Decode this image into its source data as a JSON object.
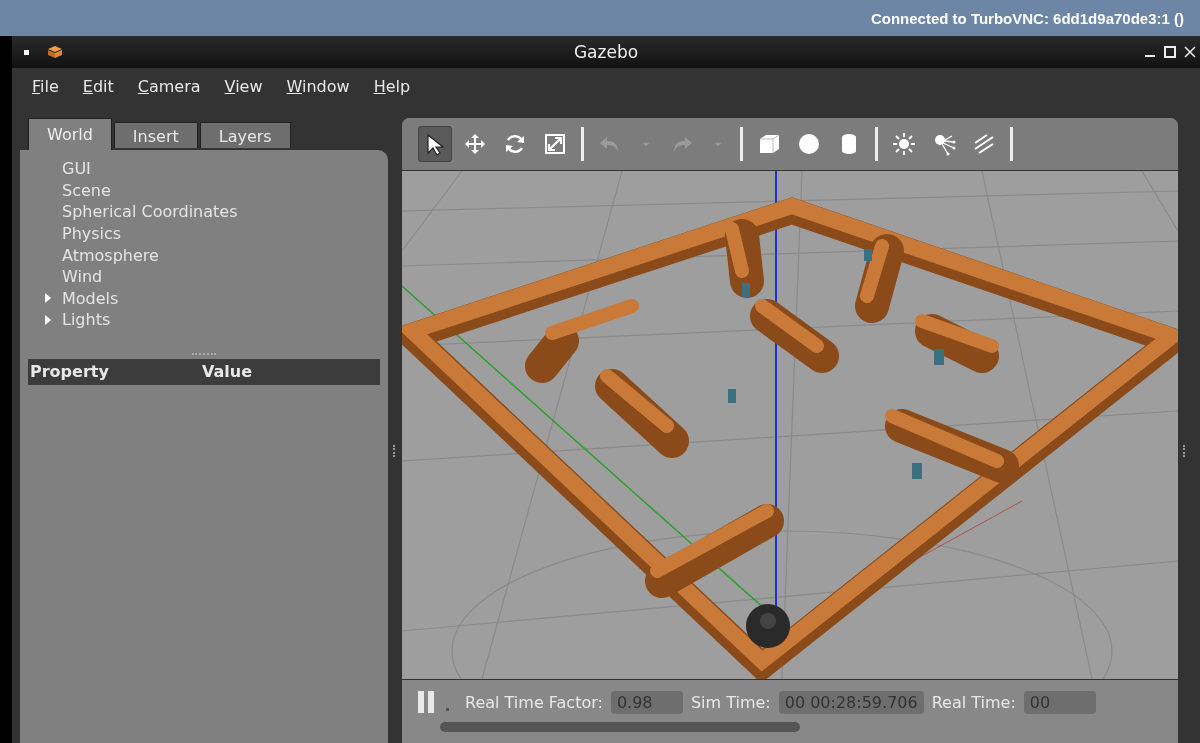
{
  "vnc_bar": {
    "title": "Connected to TurboVNC: 6dd1d9a70de3:1 ()"
  },
  "window": {
    "title": "Gazebo"
  },
  "menu": [
    "File",
    "Edit",
    "Camera",
    "View",
    "Window",
    "Help"
  ],
  "left_panel": {
    "tabs": [
      {
        "label": "World",
        "selected": true
      },
      {
        "label": "Insert",
        "selected": false
      },
      {
        "label": "Layers",
        "selected": false
      }
    ],
    "tree": [
      {
        "label": "GUI",
        "expandable": false
      },
      {
        "label": "Scene",
        "expandable": false
      },
      {
        "label": "Spherical Coordinates",
        "expandable": false
      },
      {
        "label": "Physics",
        "expandable": false
      },
      {
        "label": "Atmosphere",
        "expandable": false
      },
      {
        "label": "Wind",
        "expandable": false
      },
      {
        "label": "Models",
        "expandable": true
      },
      {
        "label": "Lights",
        "expandable": true
      }
    ],
    "property_table": {
      "columns": [
        "Property",
        "Value"
      ]
    }
  },
  "toolbar": [
    {
      "kind": "select",
      "selected": true,
      "disabled": false
    },
    {
      "kind": "translate",
      "selected": false,
      "disabled": false
    },
    {
      "kind": "rotate",
      "selected": false,
      "disabled": false
    },
    {
      "kind": "scale",
      "selected": false,
      "disabled": false
    },
    {
      "kind": "sep"
    },
    {
      "kind": "undo",
      "selected": false,
      "disabled": true
    },
    {
      "kind": "dropdown",
      "selected": false,
      "disabled": true
    },
    {
      "kind": "redo",
      "selected": false,
      "disabled": true
    },
    {
      "kind": "dropdown",
      "selected": false,
      "disabled": true
    },
    {
      "kind": "sep"
    },
    {
      "kind": "box",
      "selected": false,
      "disabled": false
    },
    {
      "kind": "sphere",
      "selected": false,
      "disabled": false
    },
    {
      "kind": "cylinder",
      "selected": false,
      "disabled": false
    },
    {
      "kind": "sep"
    },
    {
      "kind": "sun",
      "selected": false,
      "disabled": false
    },
    {
      "kind": "spot",
      "selected": false,
      "disabled": false
    },
    {
      "kind": "directional",
      "selected": false,
      "disabled": false
    },
    {
      "kind": "sep"
    }
  ],
  "bottom_bar": {
    "fields": [
      {
        "label": "Real Time Factor:",
        "value": "0.98"
      },
      {
        "label": "Sim Time:",
        "value": "00 00:28:59.706"
      },
      {
        "label": "Real Time:",
        "value": "00"
      }
    ]
  }
}
